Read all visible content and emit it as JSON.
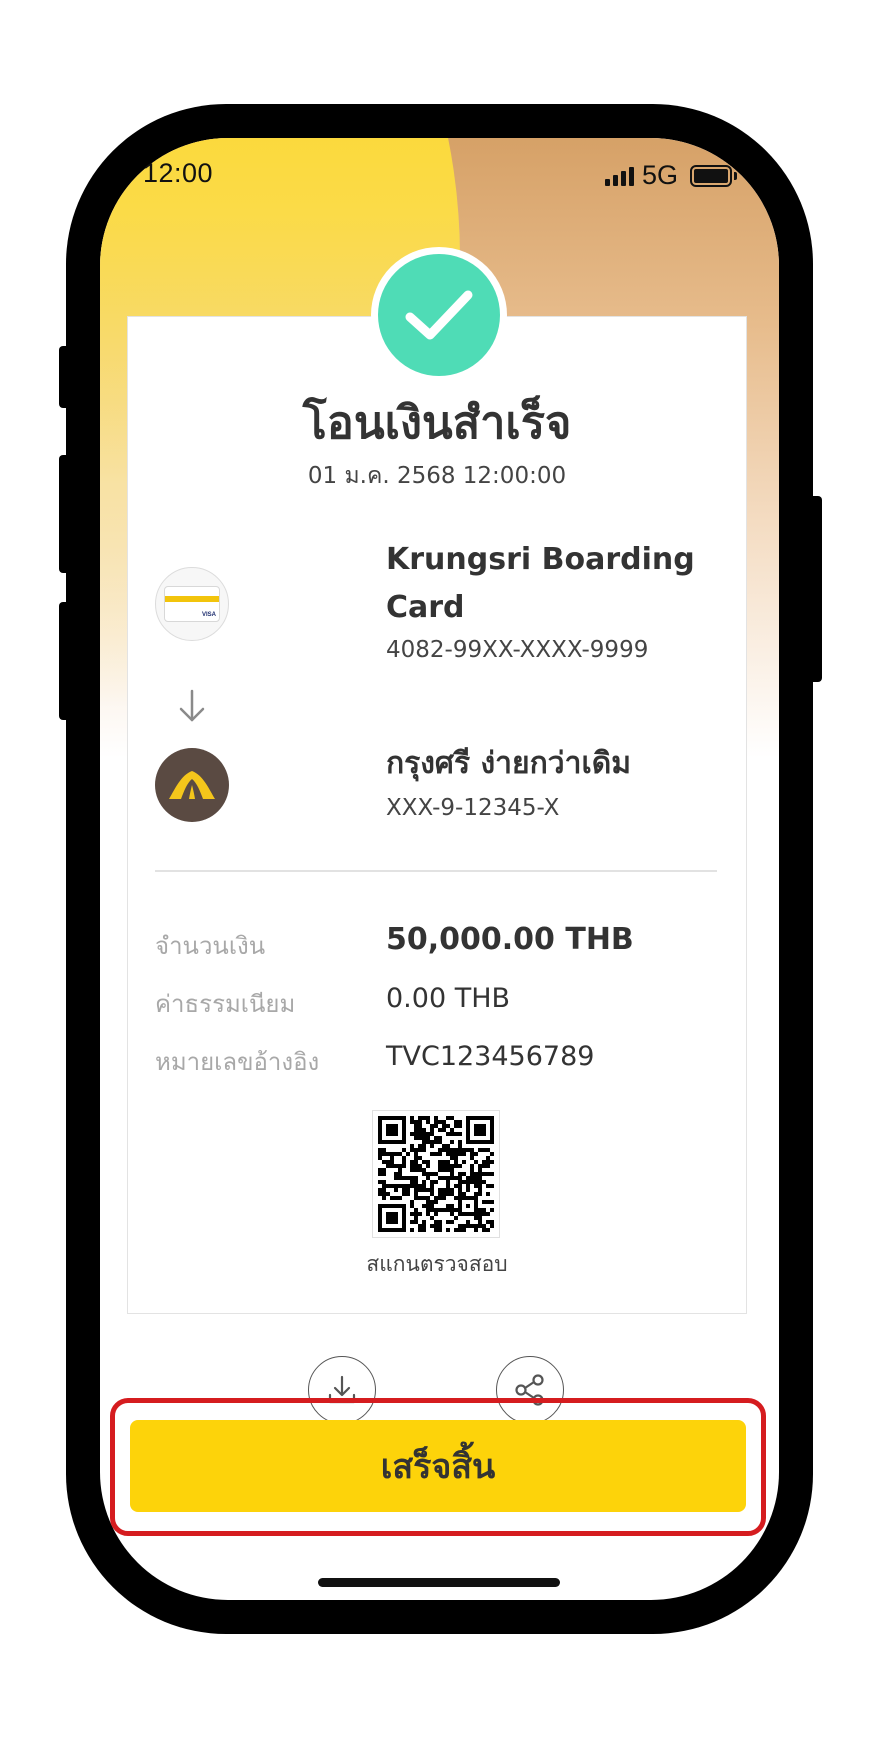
{
  "status_bar": {
    "time": "12:00",
    "network": "5G"
  },
  "receipt": {
    "title": "โอนเงินสำเร็จ",
    "datetime": "01 ม.ค. 2568 12:00:00",
    "from": {
      "name_line1": "Krungsri Boarding",
      "name_line2": "Card",
      "number": "4082-99XX-XXXX-9999",
      "card_brand": "VISA"
    },
    "to": {
      "name": "กรุงศรี ง่ายกว่าเดิม",
      "number": "XXX-9-12345-X"
    },
    "details": {
      "amount_label": "จำนวนเงิน",
      "amount_value": "50,000.00 THB",
      "fee_label": "ค่าธรรมเนียม",
      "fee_value": "0.00 THB",
      "ref_label": "หมายเลขอ้างอิง",
      "ref_value": "TVC123456789"
    },
    "qr_caption": "สแกนตรวจสอบ"
  },
  "actions": {
    "download_icon": "download-icon",
    "share_icon": "share-icon",
    "done_label": "เสร็จสิ้น"
  },
  "colors": {
    "accent_yellow": "#fdd30a",
    "success_green": "#4fdcb6",
    "highlight_red": "#d51c1f",
    "bank_brown": "#5a4a42"
  }
}
